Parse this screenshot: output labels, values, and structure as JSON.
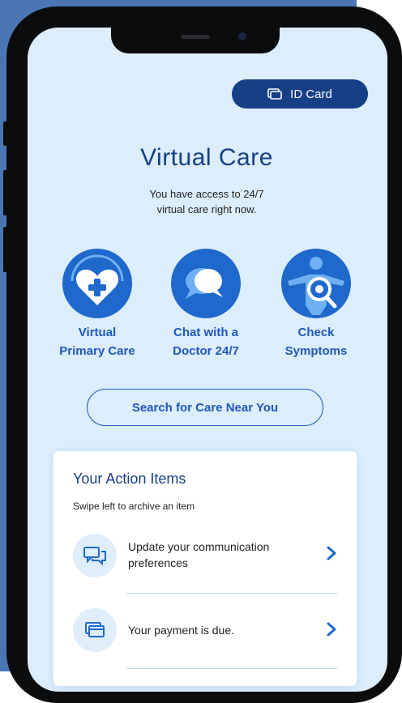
{
  "header": {
    "id_card_label": "ID Card"
  },
  "main": {
    "title": "Virtual Care",
    "subtitle_line1": "You have access to 24/7",
    "subtitle_line2": "virtual care right now."
  },
  "services": [
    {
      "line1": "Virtual",
      "line2": "Primary Care",
      "icon": "heart-plus-icon"
    },
    {
      "line1": "Chat with a",
      "line2": "Doctor 24/7",
      "icon": "chat-bubbles-icon"
    },
    {
      "line1": "Check",
      "line2": "Symptoms",
      "icon": "symptom-search-icon"
    }
  ],
  "search": {
    "label": "Search for Care Near You"
  },
  "actions_card": {
    "title": "Your Action Items",
    "subtitle": "Swipe left to archive an item",
    "items": [
      {
        "line1": "Update your communication",
        "line2": "preferences",
        "icon": "message-icon"
      },
      {
        "line1": "Your payment is due.",
        "line2": "",
        "icon": "card-icon"
      }
    ]
  },
  "colors": {
    "backdrop": "#4a76b5",
    "screen_bg": "#dcedfb",
    "brand_dark": "#173f86",
    "brand": "#1f68cc"
  }
}
